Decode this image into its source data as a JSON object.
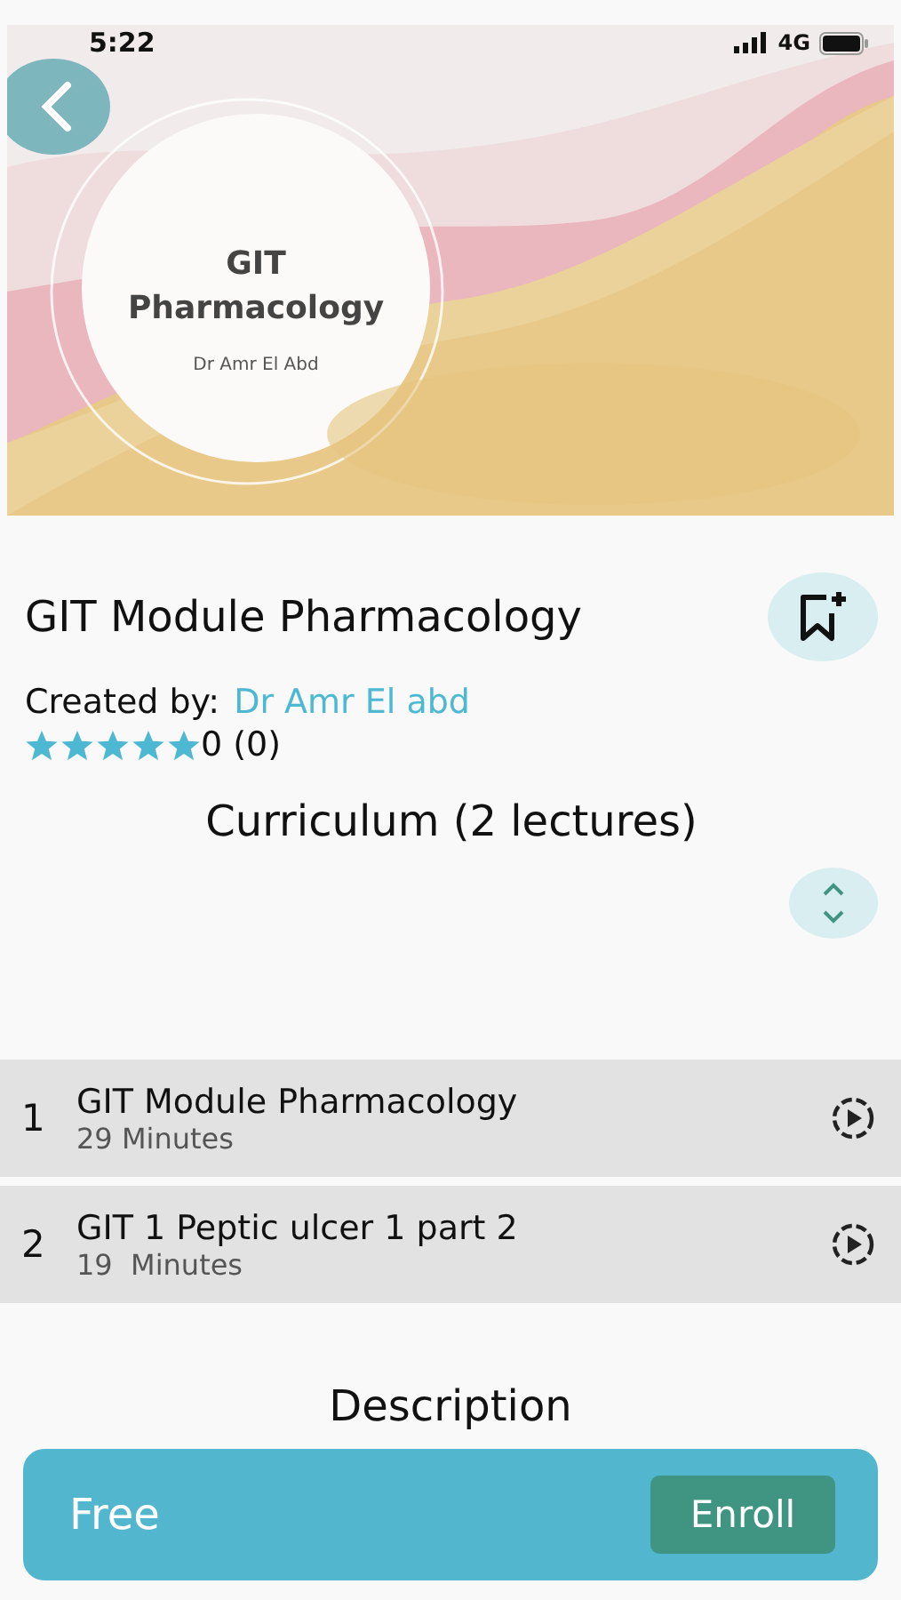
{
  "status_bar": {
    "time": "5:22",
    "network": "4G"
  },
  "cover": {
    "title": "GIT Pharmacology",
    "subtitle": "Dr Amr El Abd"
  },
  "course": {
    "title": "GIT Module Pharmacology",
    "created_by_label": "Created by:",
    "author": "Dr Amr El abd",
    "stars": 5,
    "rating": "0 (0)"
  },
  "curriculum": {
    "heading": "Curriculum (2 lectures)",
    "expanded": false
  },
  "lectures": [
    {
      "number": "1",
      "title": "GIT Module Pharmacology",
      "duration": "29 Minutes"
    },
    {
      "number": "2",
      "title": "GIT 1 Peptic ulcer 1 part 2",
      "duration": "19  Minutes"
    }
  ],
  "description": {
    "heading": "Description"
  },
  "footer": {
    "price": "Free",
    "button": "Enroll"
  }
}
